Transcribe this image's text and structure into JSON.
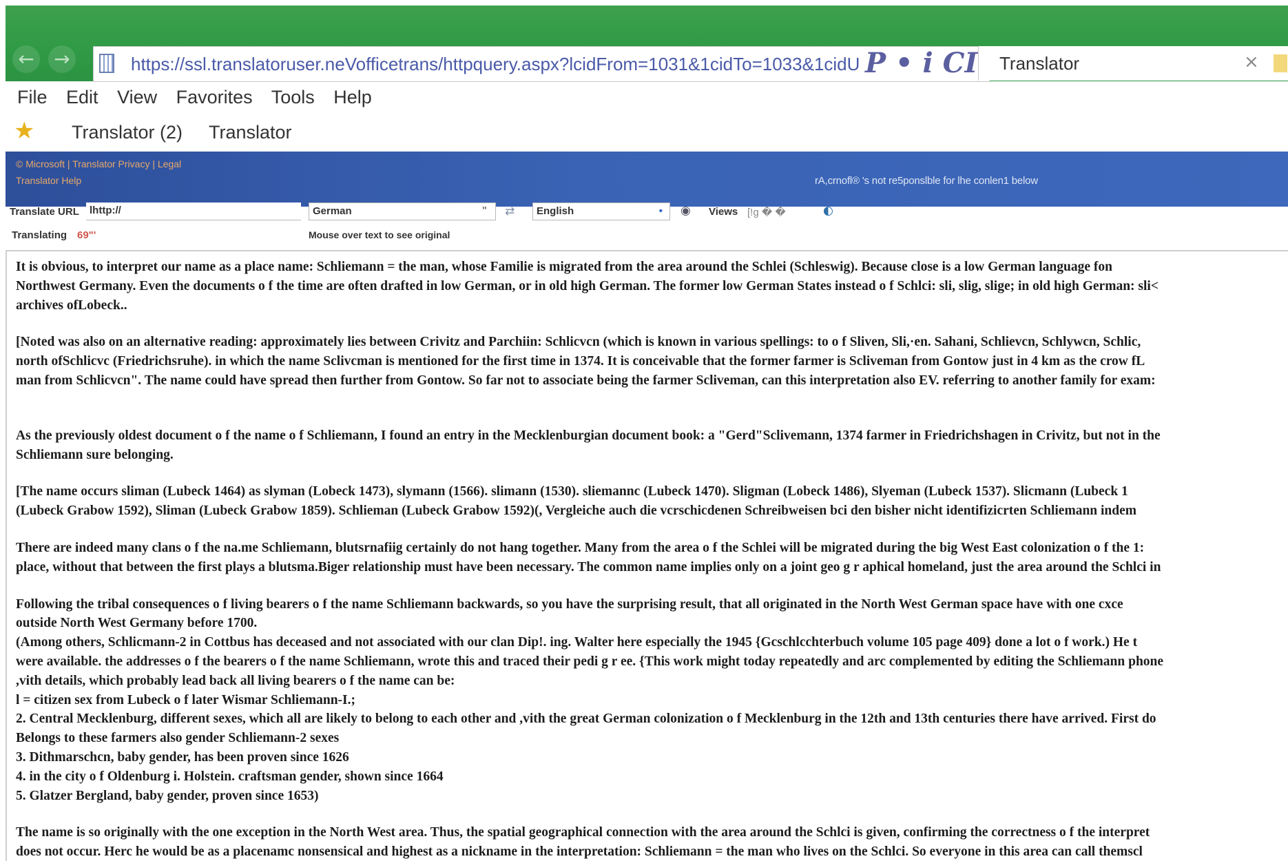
{
  "browser": {
    "url": "https://ssl.translatoruser.neVofficetrans/httpquery.aspx?lcidFrom=1031&1cidTo=1033&1cidU",
    "addr_controls": "P • i CI",
    "tab_title": "Translator",
    "back": "←",
    "forward": "→",
    "close": "×"
  },
  "menu": [
    "File",
    "Edit",
    "View",
    "Favorites",
    "Tools",
    "Help"
  ],
  "favorites": {
    "star": "★",
    "items": [
      "Translator (2)",
      "Translator"
    ]
  },
  "banner": {
    "links_row1": "© Microsoft  |  Translator Privacy  |  Legal",
    "links_row2": "Translator Help",
    "disclaimer": "rA,crnofl® 's not re5ponslble for lhe conlen1 below"
  },
  "toolbar": {
    "translate_url_label": "Translate URL",
    "url_value": "lhttp://",
    "from_lang": "German",
    "from_arrow": "\"",
    "to_lang": "English",
    "to_arrow": "•",
    "views_label": "Views",
    "views_glyphs": "[!g  �   �",
    "translating_label": "Translating",
    "translating_value": "69\"'",
    "hint": "Mouse over text to see original"
  },
  "document": {
    "p1": [
      "It is obvious, to interpret our name as a place name: Schliemann = the man, whose Familie is migrated from the area around the Schlei (Schleswig). Because close is a low German language fon",
      "Northwest Germany. Even the documents o f the time are often drafted in low German, or in old high German. The former low German States instead o f Schlci: sli, slig, slige; in old high German: sli<",
      "archives ofLobeck.."
    ],
    "p2": [
      "[Noted was also on an alternative reading: approximately lies between Crivitz and Parchiin: Schlicvcn (which is known in various spellings: to o f Sliven, Sli,·en. Sahani, Schlievcn, Schlywcn, Schlic,",
      "north ofSchlicvc (Friedrichsruhe). in which the name Sclivcman is mentioned for the first time in 1374. It is conceivable that the former farmer is Scliveman from Gontow just in 4 km as the crow fL",
      "man from Schlicvcn\". The name could have spread then further from Gontow. So far not to associate being the farmer Scliveman, can this interpretation also EV. referring to another family for exam:"
    ],
    "p3": [
      "As the previously oldest document o f the name o f Schliemann, I found an entry in the Mecklenburgian document book: a \"Gerd\"Sclivemann, 1374 farmer in Friedrichshagen in Crivitz, but not in the",
      "Schliemann sure belonging."
    ],
    "p4": [
      "[The name occurs sliman (Lubeck 1464) as slyman (Lobeck 1473), slymann (1566). slimann (1530). sliemannc (Lubeck 1470). Sligman (Lobeck 1486), Slyeman (Lubeck 1537). Slicmann (Lubeck 1",
      "(Lubeck Grabow 1592), Sliman (Lubeck Grabow 1859). Schlieman (Lubeck Grabow 1592)(, Vergleiche auch die vcrschicdenen Schreibweisen bci den bisher nicht identifizicrten Schliemann indem"
    ],
    "p5": [
      "There are indeed many clans o f the na.me Schliemann, blutsrnafiig certainly do not hang together. Many from the area o f the Schlei will be migrated during the big West East colonization o f the 1:",
      "place, without that between the first plays a blutsma.Biger relationship must have been necessary. The common name implies only on a joint geo g r aphical homeland, just the area around the Schlci in"
    ],
    "p6": [
      "Following the tribal consequences o f living bearers o f the name Schliemann backwards, so you have the surprising result, that all originated in the North West German space have with one cxce",
      "outside North West Germany before 1700.",
      "(Among others, Schlicmann-2 in Cottbus has deceased and not associated with our clan Dip!. ing. Walter here especially the 1945 {Gcschlcchterbuch volume 105 page 409} done a lot o f work.) He t",
      "were available. the addresses o f the bearers o f the name Schliemann, wrote this and traced their pedi g r ee. {This work might today repeatedly and arc complemented by editing the Schliemann phone",
      ",vith details, which probably lead back all living bearers o f the name can be:",
      "l = citizen sex from Lubeck o f later Wismar Schliemann-I.;",
      "2. Central Mecklenburg, different sexes, which all are likely to belong to each other and ,vith the great German colonization o f Mecklenburg in the 12th and 13th centuries there have arrived. First do",
      "Belongs to these farmers also gender Schliemann-2 sexes",
      "3. Dithmarschcn, baby gender, has been proven since 1626",
      "4. in the city o f Oldenburg i. Holstein. craftsman gender, shown since 1664",
      "5. Glatzer Bergland, baby gender, proven since 1653)"
    ],
    "p7": [
      "The name is so originally with the one exception in the North West area. Thus, the spatial geographical connection with the area around the Schlci is given, confirming the correctness o f the interpret",
      "does not occur. Herc he would be as a placenamc nonsensical and highest as a nickname in the interpretation: Schliemann = the man who lives on the Schlci. So everyone in this area can call themscl"
    ]
  }
}
